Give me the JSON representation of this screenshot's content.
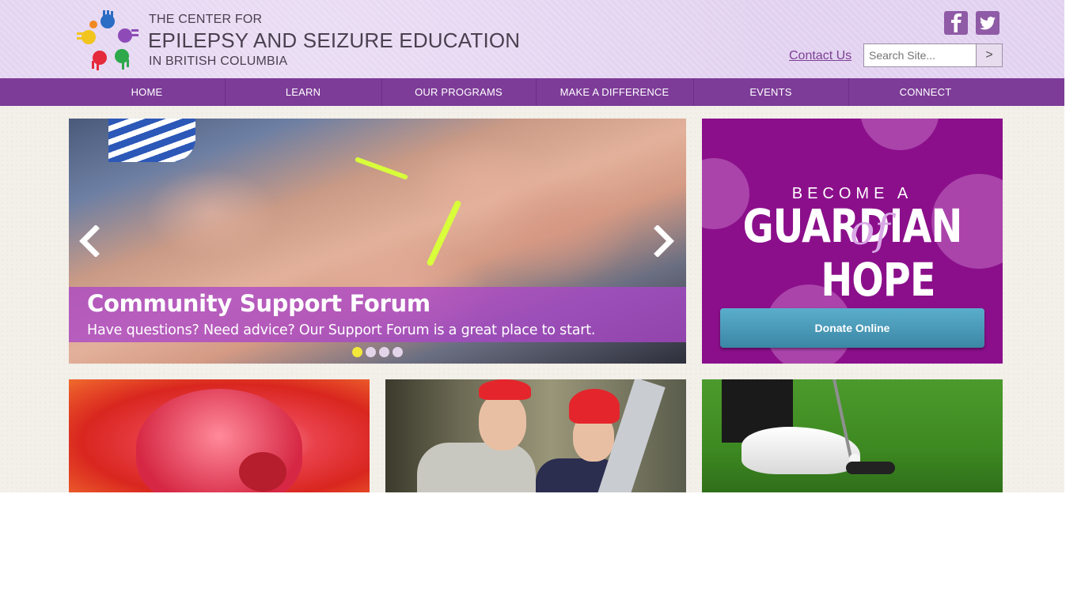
{
  "org": {
    "line1": "THE CENTER FOR",
    "line2": "EPILEPSY AND SEIZURE EDUCATION",
    "line3": "IN BRITISH COLUMBIA"
  },
  "header": {
    "contact_label": "Contact Us",
    "search_placeholder": "Search Site...",
    "search_button_label": ">",
    "social_icons": [
      "facebook-icon",
      "twitter-icon"
    ]
  },
  "nav": {
    "items": [
      "HOME",
      "LEARN",
      "OUR PROGRAMS",
      "MAKE A DIFFERENCE",
      "EVENTS",
      "CONNECT"
    ]
  },
  "slider": {
    "title": "Community Support Forum",
    "text": "Have questions? Need advice? Our Support Forum is a great place to start.",
    "slide_count": 4,
    "active_slide": 1
  },
  "donate": {
    "become": "BECOME A",
    "guardian": "GUARDIAN",
    "of": "of",
    "hope": "HOPE",
    "button_label": "Donate Online"
  },
  "colors": {
    "header_bg": "#e5d5f3",
    "nav_bg": "#7d3c98",
    "donate_bg": "#8b0f8b",
    "caption_bg": "#aa46c8",
    "donate_button": "#4a9bbb"
  }
}
